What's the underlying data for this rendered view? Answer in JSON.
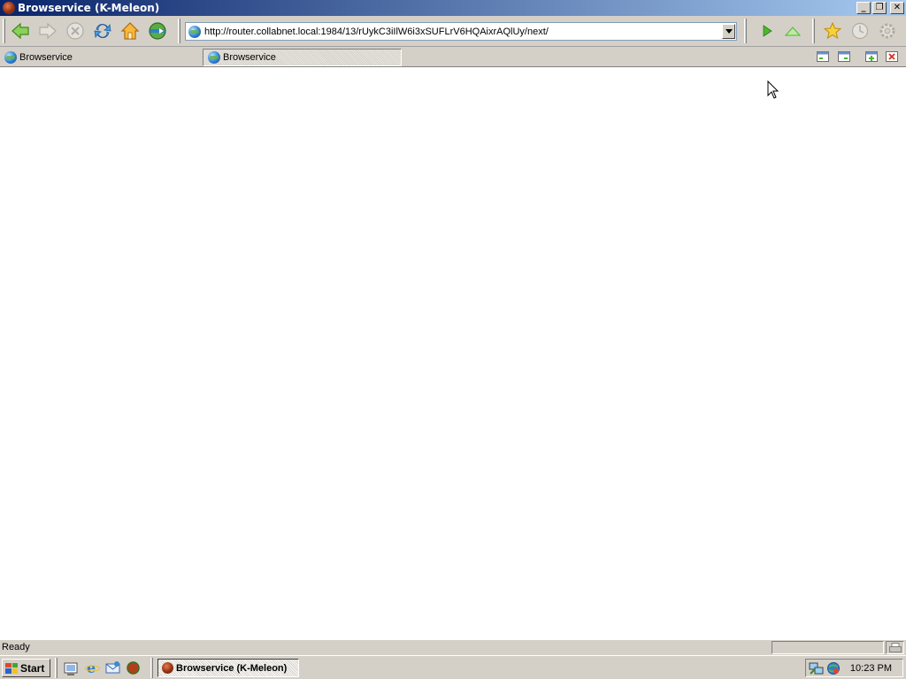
{
  "window": {
    "title": "Browservice (K-Meleon)",
    "buttons": [
      "minimize",
      "restore",
      "close"
    ]
  },
  "toolbar": {
    "buttons": [
      {
        "name": "back",
        "icon": "back-arrow-icon",
        "enabled": true
      },
      {
        "name": "forward",
        "icon": "forward-arrow-icon",
        "enabled": false
      },
      {
        "name": "stop",
        "icon": "stop-icon",
        "enabled": false
      },
      {
        "name": "reload",
        "icon": "reload-icon",
        "enabled": true
      },
      {
        "name": "home",
        "icon": "home-icon",
        "enabled": true
      },
      {
        "name": "search",
        "icon": "globe-search-icon",
        "enabled": true
      }
    ],
    "right_buttons": [
      {
        "name": "go",
        "icon": "play-icon"
      },
      {
        "name": "up",
        "icon": "up-triangle-icon"
      },
      {
        "name": "bookmarks",
        "icon": "star-icon"
      },
      {
        "name": "history",
        "icon": "clock-icon"
      },
      {
        "name": "preferences",
        "icon": "gear-icon"
      }
    ]
  },
  "address": {
    "url": "http://router.collabnet.local:1984/13/rUykC3iIlW6i3xSUFLrV6HQAixrAQlUy/next/"
  },
  "tabs": [
    {
      "label": "Browservice",
      "active": false
    },
    {
      "label": "Browservice",
      "active": true
    }
  ],
  "status": {
    "text": "Ready"
  },
  "taskbar": {
    "start_label": "Start",
    "quick_launch": [
      "show-desktop-icon",
      "internet-explorer-icon",
      "outlook-express-icon",
      "k-meleon-icon"
    ],
    "tasks": [
      {
        "label": "Browservice (K-Meleon)"
      }
    ],
    "clock": "10:23 PM",
    "tray_icons": [
      "network-icon",
      "globe-tray-icon"
    ]
  },
  "colors": {
    "titlebar_start": "#0a246a",
    "titlebar_end": "#a6caf0",
    "chrome": "#d4d0c8",
    "accent_green": "#3fa53a"
  }
}
